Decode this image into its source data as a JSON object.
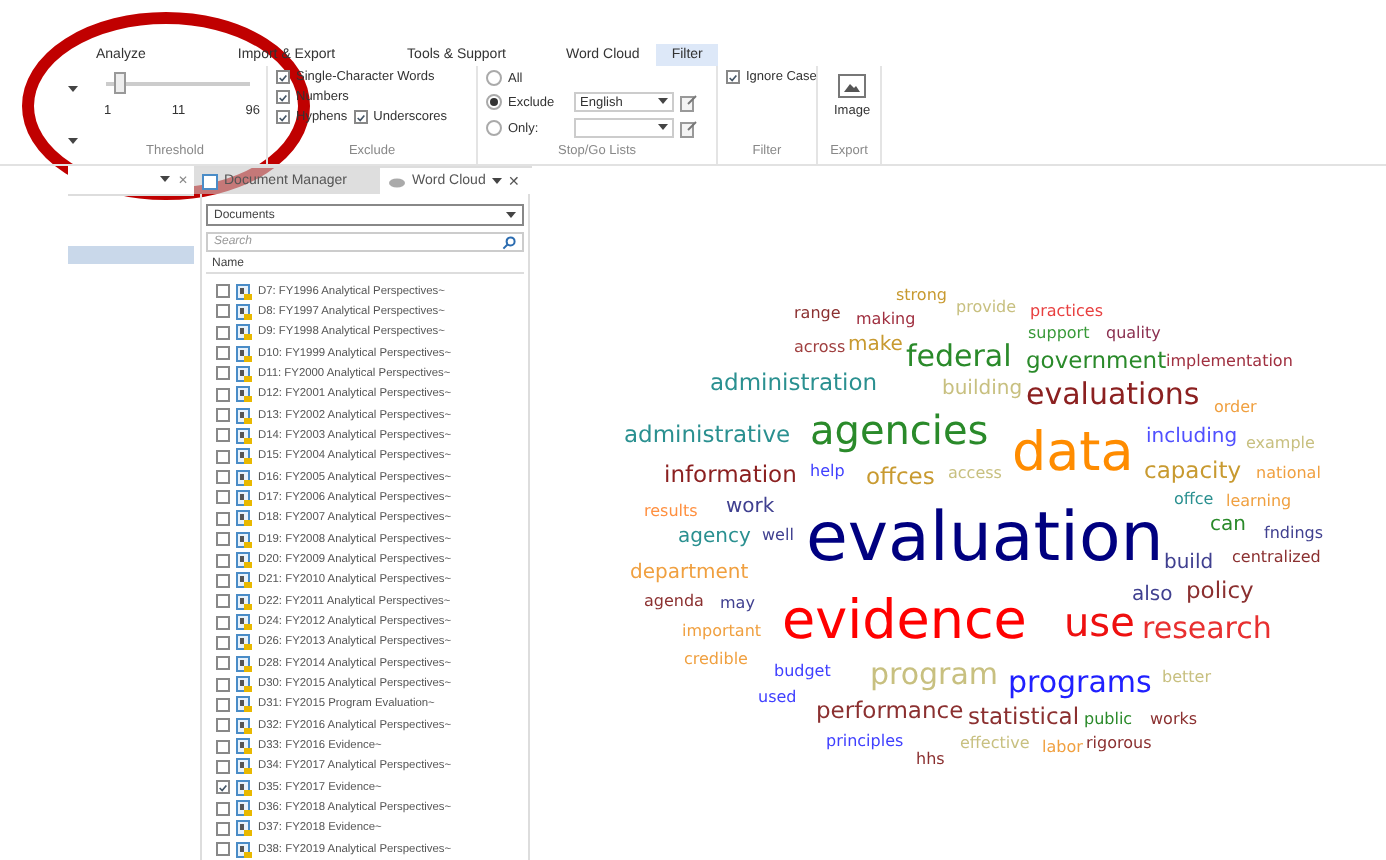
{
  "ribbon": {
    "tabs": [
      {
        "label": "Analyze",
        "selected": false
      },
      {
        "label": "Import & Export",
        "selected": false
      },
      {
        "label": "Tools & Support",
        "selected": false
      },
      {
        "label": "Word Cloud",
        "selected": false
      },
      {
        "label": "Filter",
        "selected": true
      }
    ],
    "threshold": {
      "level": 0.1,
      "ticks": [
        "1",
        "11",
        "96"
      ],
      "label": "Threshold"
    },
    "exclude": {
      "options": [
        {
          "label": "Single-Character Words",
          "checked": true
        },
        {
          "label": "Numbers",
          "checked": true
        },
        {
          "label": "Hyphens",
          "checked": true
        },
        {
          "label": "Underscores",
          "checked": true
        }
      ],
      "label": "Exclude"
    },
    "stop_go": {
      "radios": [
        {
          "label": "All",
          "selected": false,
          "kind": "plain"
        },
        {
          "label": "Exclude",
          "selected": true,
          "kind": "list",
          "value": "English"
        },
        {
          "label": "Only:",
          "selected": false,
          "kind": "list"
        }
      ],
      "label": "Stop/Go Lists"
    },
    "filter": {
      "option": {
        "label": "Ignore Case",
        "checked": true
      },
      "label": "Filter"
    },
    "export": {
      "button": "Image",
      "label": "Export"
    }
  },
  "pane_close": "✕",
  "doc_tabs": [
    {
      "label": "Document Manager",
      "selected": false
    },
    {
      "label": "Word Cloud",
      "selected": true,
      "close": "✕"
    }
  ],
  "documents": {
    "dropdown": "Documents",
    "search_placeholder": "Search",
    "column": "Name",
    "rows": [
      {
        "name": "D7: FY1996 Analytical Perspectives~",
        "checked": false
      },
      {
        "name": "D8: FY1997 Analytical Perspectives~",
        "checked": false
      },
      {
        "name": "D9: FY1998 Analytical Perspectives~",
        "checked": false
      },
      {
        "name": "D10: FY1999 Analytical Perspectives~",
        "checked": false
      },
      {
        "name": "D11: FY2000 Analytical Perspectives~",
        "checked": false
      },
      {
        "name": "D12: FY2001 Analytical Perspectives~",
        "checked": false
      },
      {
        "name": "D13: FY2002 Analytical Perspectives~",
        "checked": false
      },
      {
        "name": "D14: FY2003 Analytical Perspectives~",
        "checked": false
      },
      {
        "name": "D15: FY2004 Analytical Perspectives~",
        "checked": false
      },
      {
        "name": "D16: FY2005 Analytical Perspectives~",
        "checked": false
      },
      {
        "name": "D17: FY2006 Analytical Perspectives~",
        "checked": false
      },
      {
        "name": "D18: FY2007 Analytical Perspectives~",
        "checked": false
      },
      {
        "name": "D19: FY2008 Analytical Perspectives~",
        "checked": false
      },
      {
        "name": "D20: FY2009 Analytical Perspectives~",
        "checked": false
      },
      {
        "name": "D21: FY2010 Analytical Perspectives~",
        "checked": false
      },
      {
        "name": "D22: FY2011 Analytical Perspectives~",
        "checked": false
      },
      {
        "name": "D24: FY2012 Analytical Perspectives~",
        "checked": false
      },
      {
        "name": "D26: FY2013 Analytical Perspectives~",
        "checked": false
      },
      {
        "name": "D28: FY2014 Analytical Perspectives~",
        "checked": false
      },
      {
        "name": "D30: FY2015 Analytical Perspectives~",
        "checked": false
      },
      {
        "name": "D31: FY2015 Program Evaluation~",
        "checked": false
      },
      {
        "name": "D32: FY2016 Analytical Perspectives~",
        "checked": false
      },
      {
        "name": "D33: FY2016 Evidence~",
        "checked": false
      },
      {
        "name": "D34: FY2017 Analytical Perspectives~",
        "checked": false
      },
      {
        "name": "D35: FY2017 Evidence~",
        "checked": true
      },
      {
        "name": "D36: FY2018 Analytical Perspectives~",
        "checked": false
      },
      {
        "name": "D37: FY2018 Evidence~",
        "checked": false
      },
      {
        "name": "D38: FY2019 Analytical Perspectives~",
        "checked": false
      }
    ]
  },
  "word_cloud": [
    {
      "word": "range",
      "kind": "small",
      "color": "#8b3030"
    },
    {
      "word": "making",
      "kind": "small",
      "color": "#a03040"
    },
    {
      "word": "strong",
      "kind": "small",
      "color": "#c89a30"
    },
    {
      "word": "provide",
      "kind": "small",
      "color": "#c8c080"
    },
    {
      "word": "practices",
      "kind": "small",
      "color": "#e84040"
    },
    {
      "word": "support",
      "kind": "small",
      "color": "#3a9a3a"
    },
    {
      "word": "quality",
      "kind": "small",
      "color": "#8b3050"
    },
    {
      "word": "across",
      "kind": "small",
      "color": "#a04040"
    },
    {
      "word": "make",
      "kind": "medium",
      "color": "#c89a30"
    },
    {
      "word": "federal",
      "kind": "large",
      "color": "#2a8a2a"
    },
    {
      "word": "government",
      "kind": "bigger",
      "color": "#2a8a2a"
    },
    {
      "word": "implementation",
      "kind": "small",
      "color": "#a03040"
    },
    {
      "word": "administration",
      "kind": "bigger",
      "color": "#2a9090"
    },
    {
      "word": "building",
      "kind": "medium",
      "color": "#c8c080"
    },
    {
      "word": "evaluations",
      "kind": "large",
      "color": "#8b2020"
    },
    {
      "word": "order",
      "kind": "small",
      "color": "#f0a040"
    },
    {
      "word": "administrative",
      "kind": "bigger",
      "color": "#2a9090"
    },
    {
      "word": "agencies",
      "kind": "huge",
      "color": "#2a8a2a"
    },
    {
      "word": "data",
      "kind": "massive",
      "color": "#ff8c00"
    },
    {
      "word": "including",
      "kind": "medium",
      "color": "#5050ff"
    },
    {
      "word": "example",
      "kind": "small",
      "color": "#c8c080"
    },
    {
      "word": "information",
      "kind": "bigger",
      "color": "#8b2020"
    },
    {
      "word": "help",
      "kind": "small",
      "color": "#4040ff"
    },
    {
      "word": "offces",
      "kind": "bigger",
      "color": "#c89a30"
    },
    {
      "word": "access",
      "kind": "small",
      "color": "#c8c080"
    },
    {
      "word": "capacity",
      "kind": "bigger",
      "color": "#c89a30"
    },
    {
      "word": "national",
      "kind": "small",
      "color": "#f0a040"
    },
    {
      "word": "offce",
      "kind": "small",
      "color": "#2a9090"
    },
    {
      "word": "learning",
      "kind": "small",
      "color": "#f0a040"
    },
    {
      "word": "results",
      "kind": "small",
      "color": "#ff9040"
    },
    {
      "word": "work",
      "kind": "medium",
      "color": "#404090"
    },
    {
      "word": "agency",
      "kind": "medium",
      "color": "#2a9090"
    },
    {
      "word": "well",
      "kind": "small",
      "color": "#404090"
    },
    {
      "word": "evaluation",
      "kind": "giant",
      "color": "#000080"
    },
    {
      "word": "can",
      "kind": "medium",
      "color": "#2a8a2a"
    },
    {
      "word": "fndings",
      "kind": "small",
      "color": "#404090"
    },
    {
      "word": "build",
      "kind": "medium",
      "color": "#404090"
    },
    {
      "word": "centralized",
      "kind": "small",
      "color": "#8b3030"
    },
    {
      "word": "department",
      "kind": "medium",
      "color": "#f0a040"
    },
    {
      "word": "agenda",
      "kind": "small",
      "color": "#8b3030"
    },
    {
      "word": "may",
      "kind": "small",
      "color": "#404090"
    },
    {
      "word": "also",
      "kind": "medium",
      "color": "#404090"
    },
    {
      "word": "policy",
      "kind": "bigger",
      "color": "#8b3030"
    },
    {
      "word": "important",
      "kind": "small",
      "color": "#f0a040"
    },
    {
      "word": "evidence",
      "kind": "massive",
      "color": "#ff0000"
    },
    {
      "word": "use",
      "kind": "huge",
      "color": "#ee1010"
    },
    {
      "word": "research",
      "kind": "large",
      "color": "#e83030"
    },
    {
      "word": "credible",
      "kind": "small",
      "color": "#f0a040"
    },
    {
      "word": "budget",
      "kind": "small",
      "color": "#4040ff"
    },
    {
      "word": "program",
      "kind": "large",
      "color": "#c8c080"
    },
    {
      "word": "programs",
      "kind": "large",
      "color": "#2020ff"
    },
    {
      "word": "better",
      "kind": "small",
      "color": "#c8c080"
    },
    {
      "word": "used",
      "kind": "small",
      "color": "#4040ff"
    },
    {
      "word": "performance",
      "kind": "bigger",
      "color": "#8b3030"
    },
    {
      "word": "statistical",
      "kind": "bigger",
      "color": "#8b3030"
    },
    {
      "word": "public",
      "kind": "small",
      "color": "#2a8a2a"
    },
    {
      "word": "works",
      "kind": "small",
      "color": "#8b3030"
    },
    {
      "word": "principles",
      "kind": "small",
      "color": "#4040ff"
    },
    {
      "word": "effective",
      "kind": "small",
      "color": "#c8c080"
    },
    {
      "word": "labor",
      "kind": "small",
      "color": "#f0a040"
    },
    {
      "word": "rigorous",
      "kind": "small",
      "color": "#8b3030"
    },
    {
      "word": "hhs",
      "kind": "small",
      "color": "#8b3030"
    }
  ]
}
